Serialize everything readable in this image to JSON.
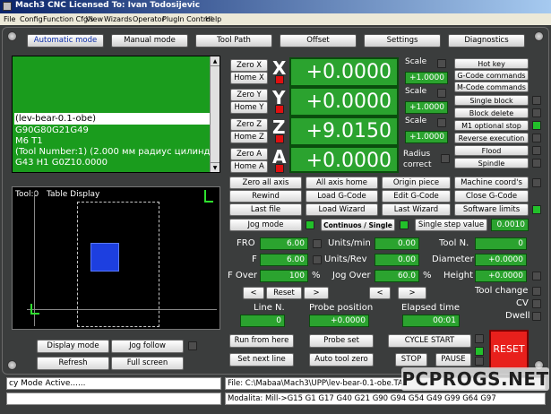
{
  "window": {
    "title": "Mach3 CNC  Licensed To: Ivan Todosijevic"
  },
  "menu": [
    "File",
    "Config",
    "Function Cfg's",
    "View",
    "Wizards",
    "Operator",
    "PlugIn Control",
    "Help"
  ],
  "tabs": [
    "Automatic mode",
    "Manual mode",
    "Tool Path",
    "Offset",
    "Settings",
    "Diagnostics"
  ],
  "gcode_lines": [
    "(lev-bear-0.1-obe)",
    "G90G80G21G49",
    "M6 T1",
    "(Tool Number:1) (2.000 мм радиус цилинд",
    "G43 H1 G0Z10.0000"
  ],
  "table_display": {
    "tool": "Tool:0",
    "title": "Table Display"
  },
  "axes": [
    {
      "letter": "X",
      "zero": "Zero X",
      "home": "Home X",
      "value": "+0.0000",
      "side_label": "Scale",
      "side_value": "+1.0000"
    },
    {
      "letter": "Y",
      "zero": "Zero Y",
      "home": "Home Y",
      "value": "+0.0000",
      "side_label": "Scale",
      "side_value": "+1.0000"
    },
    {
      "letter": "Z",
      "zero": "Zero Z",
      "home": "Home Z",
      "value": "+9.0150",
      "side_label": "Scale",
      "side_value": "+1.0000"
    },
    {
      "letter": "A",
      "zero": "Zero A",
      "home": "Home A",
      "value": "+0.0000",
      "side_label": "Radius correct",
      "side_value": ""
    }
  ],
  "right_buttons": [
    "Hot key",
    "G-Code commands",
    "M-Code commands",
    "Single block",
    "Block delete",
    "M1 optional stop",
    "Reverse execution",
    "Flood",
    "Spindle"
  ],
  "grid_buttons": [
    [
      "Zero all axis",
      "All axis home",
      "Origin piece",
      "Machine coord's"
    ],
    [
      "Rewind",
      "Load G-Code",
      "Edit G-Code",
      "Close G-Code"
    ],
    [
      "Last file",
      "Load Wizard",
      "Last Wizard",
      "Software limits"
    ]
  ],
  "jog": {
    "jog_mode": "Jog mode",
    "cont_single": "Continuos / Single",
    "single_step": "Single step value",
    "single_step_value": "0.0010"
  },
  "feeds": {
    "fro_label": "FRO",
    "fro_value": "6.00",
    "f_label": "F",
    "f_value": "6.00",
    "fover_label": "F Over",
    "fover_value": "100",
    "pct": "%",
    "units_min_label": "Units/min",
    "units_min_value": "0.00",
    "units_rev_label": "Units/Rev",
    "units_rev_value": "0.00",
    "jog_over_label": "Jog Over",
    "jog_over_value": "60.0",
    "pct2": "%",
    "tool_n_label": "Tool N.",
    "tool_n_value": "0",
    "diameter_label": "Diameter",
    "diameter_value": "+0.0000",
    "height_label": "Height",
    "height_value": "+0.0000"
  },
  "nav": {
    "prev": "<",
    "reset": "Reset",
    "next": ">",
    "prev2": "<",
    "next2": ">"
  },
  "status_leds": {
    "tool_change": "Tool change",
    "cv": "CV",
    "dwell": "Dwell"
  },
  "line_n": {
    "label": "Line N.",
    "value": "0"
  },
  "probe": {
    "label": "Probe position",
    "value": "+0.0000"
  },
  "elapsed": {
    "label": "Elapsed time",
    "value": "00:01"
  },
  "bottom_buttons": {
    "display_mode": "Display mode",
    "jog_follow": "Jog follow",
    "refresh": "Refresh",
    "full_screen": "Full screen",
    "run_from_here": "Run from here",
    "set_next_line": "Set next line",
    "probe_set": "Probe set",
    "auto_tool_zero": "Auto tool zero",
    "cycle_start": "CYCLE START",
    "stop": "STOP",
    "pause": "PAUSE",
    "reset": "RESET"
  },
  "status_bar": {
    "message": "cy Mode Active......",
    "file": "File: C:\\Mabaa\\Mach3\\UPP\\lev-bear-0.1-obe.TAP",
    "modal": "Modalita: Mill->G15  G1 G17 G40 G21 G90 G94 G54 G49 G99 G64 G97"
  },
  "watermark": "PCPROGS.NET",
  "colors": {
    "dro_green": "#2ba32f",
    "led_green": "#22c02a",
    "led_red": "#e01010",
    "reset_red": "#e8201c",
    "panel": "#3b3d3d"
  }
}
